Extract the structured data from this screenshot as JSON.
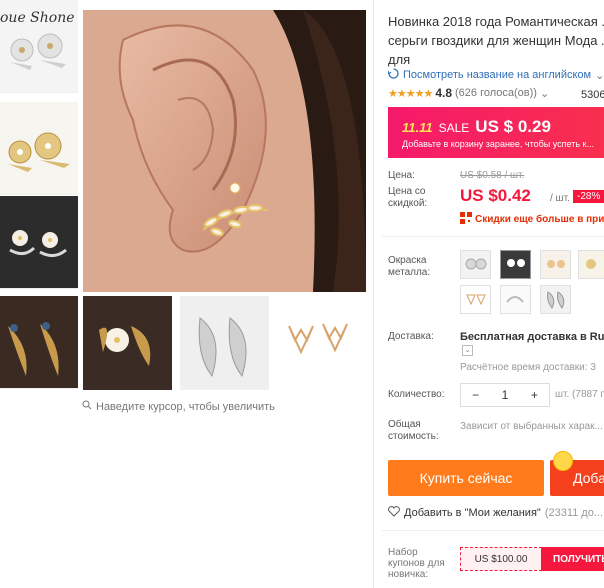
{
  "gallery": {
    "brand": "oue Shone",
    "zoom_hint": "Наведите курсор, чтобы увеличить"
  },
  "product": {
    "title_lines": [
      "Новинка 2018 года Романтическая ...",
      "серьги гвоздики для женщин Мода ...",
      "для"
    ],
    "translate_link": "Посмотреть название на английском",
    "rating_value": "4.8",
    "rating_count": "(626 голоса(ов))",
    "orders": "5306"
  },
  "promo": {
    "tag": "11.11",
    "sale": "SALE",
    "price": "US $ 0.29",
    "subtitle": "Добавьте в корзину заранее, чтобы успеть к..."
  },
  "pricing": {
    "price_label": "Цена:",
    "old_price": "US $0.58 / шт.",
    "discount_label": "Цена со скидкой:",
    "new_price": "US $0.42",
    "per_unit": "/ шт.",
    "discount": "-28%",
    "coins_text": "Скидки еще больше в при..."
  },
  "options": {
    "metal_label": "Окраска металла:"
  },
  "shipping": {
    "label": "Доставка:",
    "value": "Бесплатная доставка в Russ...",
    "time": "Расчётное время доставки: 3"
  },
  "quantity": {
    "label": "Количество:",
    "value": "1",
    "minus": "−",
    "plus": "+",
    "available": "шт. (7887 п..."
  },
  "total": {
    "label": "Общая стоимость:",
    "value": "Зависит от выбранных харак..."
  },
  "actions": {
    "buy_now": "Купить сейчас",
    "add_to_cart": "Доба...",
    "wishlist": "Добавить в \"Мои желания\"",
    "wishlist_count": "(23311 до..."
  },
  "coupon": {
    "label": "Набор купонов для новичка:",
    "value": "US $100.00",
    "get": "ПОЛУЧИТЬ"
  },
  "colors": {
    "accent_red": "#f5173d",
    "buy_orange": "#ff7b1c",
    "cart_red": "#f5401d",
    "link_blue": "#2f6fb8",
    "star_orange": "#f19e1b"
  }
}
